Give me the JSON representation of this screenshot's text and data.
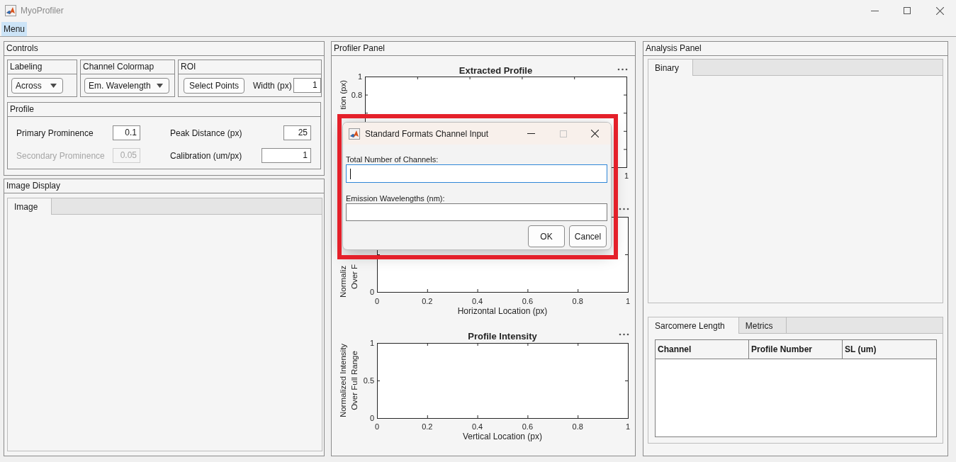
{
  "window": {
    "title": "MyoProfiler",
    "active": false
  },
  "menu_bar": {
    "items": [
      {
        "label": "Menu",
        "highlighted": true
      }
    ]
  },
  "controls": {
    "title": "Controls",
    "labeling": {
      "title": "Labeling",
      "dropdown": {
        "value": "Across"
      }
    },
    "channel_colormap": {
      "title": "Channel Colormap",
      "dropdown": {
        "value": "Em. Wavelength"
      }
    },
    "roi": {
      "title": "ROI",
      "button": "Select Points",
      "width_label": "Width (px)",
      "width_value": "1"
    },
    "profile": {
      "title": "Profile",
      "fields": [
        {
          "label": "Primary Prominence",
          "value": "0.1",
          "disabled": false
        },
        {
          "label": "Peak Distance (px)",
          "value": "25",
          "disabled": false
        },
        {
          "label": "Secondary Prominence",
          "value": "0.05",
          "disabled": true
        },
        {
          "label": "Calibration (um/px)",
          "value": "1",
          "disabled": false
        }
      ]
    }
  },
  "image_display": {
    "title": "Image Display",
    "tabs": [
      {
        "label": "Image",
        "selected": true
      }
    ]
  },
  "profiler_panel": {
    "title": "Profiler Panel",
    "charts": [
      {
        "kind": "partial_axes",
        "title": "Extracted Profile",
        "y_axis_label": "tion (px)",
        "y_tick_labels": [
          "1",
          "0.8"
        ],
        "x_tick_labels": [
          "1"
        ]
      },
      {
        "kind": "partial_axes",
        "x_axis_label": "Horizontal Location (px)",
        "y_axis_label": "Normaliz\nOver F",
        "x_tick_labels": [
          "0",
          "0.2",
          "0.4",
          "0.6",
          "0.8",
          "1"
        ],
        "y_tick_labels": [
          "0"
        ]
      },
      {
        "kind": "chart",
        "chart_data": {
          "type": "line",
          "title": "Profile Intensity",
          "xlabel": "Vertical Location (px)",
          "ylabel": "Normalized Intensity\nOver Full Range",
          "xlim": [
            0,
            1
          ],
          "ylim": [
            0,
            1
          ],
          "xticks": [
            0,
            0.2,
            0.4,
            0.6,
            0.8,
            1
          ],
          "yticks": [
            0,
            0.5,
            1
          ]
        }
      }
    ]
  },
  "analysis_panel": {
    "title": "Analysis Panel",
    "upper_tabs": [
      {
        "label": "Binary",
        "selected": true
      }
    ],
    "lower_tabs": [
      {
        "label": "Sarcomere Length",
        "selected": true
      },
      {
        "label": "Metrics",
        "selected": false
      }
    ],
    "table": {
      "columns": [
        "Channel",
        "Profile Number",
        "SL (um)"
      ]
    }
  },
  "dialog": {
    "title": "Standard Formats Channel Input",
    "maximize_disabled": true,
    "fields": [
      {
        "label": "Total Number of Channels:",
        "focused": true
      },
      {
        "label": "Emission Wavelengths (nm):",
        "focused": false
      }
    ],
    "buttons": [
      "OK",
      "Cancel"
    ]
  }
}
